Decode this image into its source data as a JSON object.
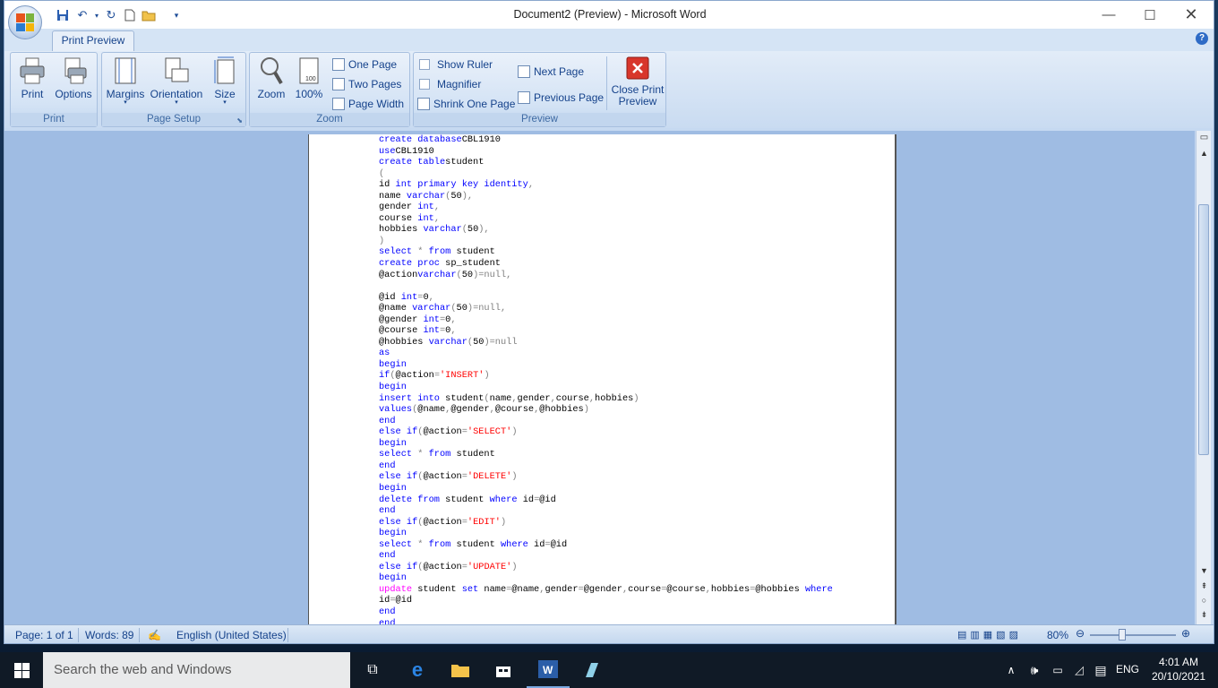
{
  "window": {
    "title": "Document2 (Preview) - Microsoft Word"
  },
  "tabs": {
    "active": "Print Preview"
  },
  "ribbon": {
    "print_group": {
      "label": "Print",
      "print": "Print",
      "options": "Options"
    },
    "page_setup_group": {
      "label": "Page Setup",
      "margins": "Margins",
      "orientation": "Orientation",
      "size": "Size"
    },
    "zoom_group": {
      "label": "Zoom",
      "zoom": "Zoom",
      "hundred": "100%",
      "one_page": "One Page",
      "two_pages": "Two Pages",
      "page_width": "Page Width"
    },
    "preview_group": {
      "label": "Preview",
      "show_ruler": "Show Ruler",
      "magnifier": "Magnifier",
      "shrink": "Shrink One Page",
      "next_page": "Next Page",
      "previous_page": "Previous Page",
      "close_1": "Close Print",
      "close_2": "Preview"
    }
  },
  "document": {
    "lines": [
      [
        [
          "kw",
          "create database"
        ],
        [
          "",
          "CBL1910"
        ]
      ],
      [
        [
          "kw",
          "use"
        ],
        [
          "",
          "CBL1910"
        ]
      ],
      [
        [
          "kw",
          "create table"
        ],
        [
          "",
          "student"
        ]
      ],
      [
        [
          "op",
          "("
        ]
      ],
      [
        [
          "",
          "id "
        ],
        [
          "kw",
          "int primary key identity"
        ],
        [
          "op",
          ","
        ]
      ],
      [
        [
          "",
          "name "
        ],
        [
          "kw",
          "varchar"
        ],
        [
          "op",
          "("
        ],
        [
          "",
          "50"
        ],
        [
          "op",
          "),"
        ]
      ],
      [
        [
          "",
          "gender "
        ],
        [
          "kw",
          "int"
        ],
        [
          "op",
          ","
        ]
      ],
      [
        [
          "",
          "course "
        ],
        [
          "kw",
          "int"
        ],
        [
          "op",
          ","
        ]
      ],
      [
        [
          "",
          "hobbies "
        ],
        [
          "kw",
          "varchar"
        ],
        [
          "op",
          "("
        ],
        [
          "",
          "50"
        ],
        [
          "op",
          "),"
        ]
      ],
      [
        [
          "op",
          ")"
        ]
      ],
      [
        [
          "kw",
          "select"
        ],
        [
          "op",
          " * "
        ],
        [
          "kw",
          "from"
        ],
        [
          "",
          " student"
        ]
      ],
      [
        [
          "kw",
          "create proc"
        ],
        [
          "",
          " sp_student"
        ]
      ],
      [
        [
          "",
          "@action"
        ],
        [
          "kw",
          "varchar"
        ],
        [
          "op",
          "("
        ],
        [
          "",
          "50"
        ],
        [
          "op",
          ")=null,"
        ]
      ],
      [],
      [
        [
          "",
          "@id "
        ],
        [
          "kw",
          "int"
        ],
        [
          "op",
          "="
        ],
        [
          "",
          "0"
        ],
        [
          "op",
          ","
        ]
      ],
      [
        [
          "",
          "@name "
        ],
        [
          "kw",
          "varchar"
        ],
        [
          "op",
          "("
        ],
        [
          "",
          "50"
        ],
        [
          "op",
          ")=null,"
        ]
      ],
      [
        [
          "",
          "@gender "
        ],
        [
          "kw",
          "int"
        ],
        [
          "op",
          "="
        ],
        [
          "",
          "0"
        ],
        [
          "op",
          ","
        ]
      ],
      [
        [
          "",
          "@course "
        ],
        [
          "kw",
          "int"
        ],
        [
          "op",
          "="
        ],
        [
          "",
          "0"
        ],
        [
          "op",
          ","
        ]
      ],
      [
        [
          "",
          "@hobbies "
        ],
        [
          "kw",
          "varchar"
        ],
        [
          "op",
          "("
        ],
        [
          "",
          "50"
        ],
        [
          "op",
          ")=null"
        ]
      ],
      [
        [
          "kw",
          "as"
        ]
      ],
      [
        [
          "kw",
          "begin"
        ]
      ],
      [
        [
          "kw",
          "if"
        ],
        [
          "op",
          "("
        ],
        [
          "",
          "@action"
        ],
        [
          "op",
          "="
        ],
        [
          "st",
          "'INSERT'"
        ],
        [
          "op",
          ")"
        ]
      ],
      [
        [
          "kw",
          "begin"
        ]
      ],
      [
        [
          "kw",
          "insert into"
        ],
        [
          "",
          " student"
        ],
        [
          "op",
          "("
        ],
        [
          "",
          "name"
        ],
        [
          "op",
          ","
        ],
        [
          "",
          "gender"
        ],
        [
          "op",
          ","
        ],
        [
          "",
          "course"
        ],
        [
          "op",
          ","
        ],
        [
          "",
          "hobbies"
        ],
        [
          "op",
          ")"
        ]
      ],
      [
        [
          "kw",
          "values"
        ],
        [
          "op",
          "("
        ],
        [
          "",
          "@name"
        ],
        [
          "op",
          ","
        ],
        [
          "",
          "@gender"
        ],
        [
          "op",
          ","
        ],
        [
          "",
          "@course"
        ],
        [
          "op",
          ","
        ],
        [
          "",
          "@hobbies"
        ],
        [
          "op",
          ")"
        ]
      ],
      [
        [
          "kw",
          "end"
        ]
      ],
      [
        [
          "kw",
          "else if"
        ],
        [
          "op",
          "("
        ],
        [
          "",
          "@action"
        ],
        [
          "op",
          "="
        ],
        [
          "st",
          "'SELECT'"
        ],
        [
          "op",
          ")"
        ]
      ],
      [
        [
          "kw",
          "begin"
        ]
      ],
      [
        [
          "kw",
          "select"
        ],
        [
          "op",
          " * "
        ],
        [
          "kw",
          "from"
        ],
        [
          "",
          " student"
        ]
      ],
      [
        [
          "kw",
          "end"
        ]
      ],
      [
        [
          "kw",
          "else if"
        ],
        [
          "op",
          "("
        ],
        [
          "",
          "@action"
        ],
        [
          "op",
          "="
        ],
        [
          "st",
          "'DELETE'"
        ],
        [
          "op",
          ")"
        ]
      ],
      [
        [
          "kw",
          "begin"
        ]
      ],
      [
        [
          "kw",
          "delete from"
        ],
        [
          "",
          " student "
        ],
        [
          "kw",
          "where"
        ],
        [
          "",
          " id"
        ],
        [
          "op",
          "="
        ],
        [
          "",
          "@id"
        ]
      ],
      [
        [
          "kw",
          "end"
        ]
      ],
      [
        [
          "kw",
          "else if"
        ],
        [
          "op",
          "("
        ],
        [
          "",
          "@action"
        ],
        [
          "op",
          "="
        ],
        [
          "st",
          "'EDIT'"
        ],
        [
          "op",
          ")"
        ]
      ],
      [
        [
          "kw",
          "begin"
        ]
      ],
      [
        [
          "kw",
          "select"
        ],
        [
          "op",
          " * "
        ],
        [
          "kw",
          "from"
        ],
        [
          "",
          " student "
        ],
        [
          "kw",
          "where"
        ],
        [
          "",
          " id"
        ],
        [
          "op",
          "="
        ],
        [
          "",
          "@id"
        ]
      ],
      [
        [
          "kw",
          "end"
        ]
      ],
      [
        [
          "kw",
          "else if"
        ],
        [
          "op",
          "("
        ],
        [
          "",
          "@action"
        ],
        [
          "op",
          "="
        ],
        [
          "st",
          "'UPDATE'"
        ],
        [
          "op",
          ")"
        ]
      ],
      [
        [
          "kw",
          "begin"
        ]
      ],
      [
        [
          "fn",
          "update"
        ],
        [
          "",
          " student "
        ],
        [
          "kw",
          "set"
        ],
        [
          "",
          " name"
        ],
        [
          "op",
          "="
        ],
        [
          "",
          "@name"
        ],
        [
          "op",
          ","
        ],
        [
          "",
          "gender"
        ],
        [
          "op",
          "="
        ],
        [
          "",
          "@gender"
        ],
        [
          "op",
          ","
        ],
        [
          "",
          "course"
        ],
        [
          "op",
          "="
        ],
        [
          "",
          "@course"
        ],
        [
          "op",
          ","
        ],
        [
          "",
          "hobbies"
        ],
        [
          "op",
          "="
        ],
        [
          "",
          "@hobbies "
        ],
        [
          "kw",
          "where"
        ]
      ],
      [
        [
          "",
          "id"
        ],
        [
          "op",
          "="
        ],
        [
          "",
          "@id"
        ]
      ],
      [
        [
          "kw",
          "end"
        ]
      ],
      [
        [
          "kw",
          "end"
        ]
      ]
    ]
  },
  "statusbar": {
    "page": "Page: 1 of 1",
    "words": "Words: 89",
    "language": "English (United States)",
    "zoom": "80%"
  },
  "taskbar": {
    "search_placeholder": "Search the web and Windows",
    "lang": "ENG",
    "time": "4:01 AM",
    "date": "20/10/2021"
  }
}
